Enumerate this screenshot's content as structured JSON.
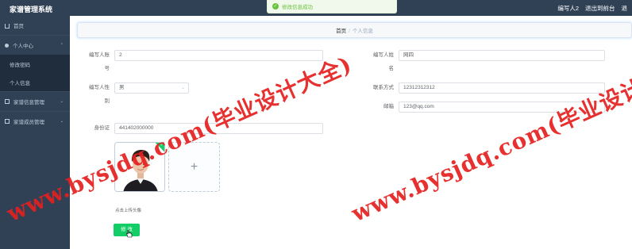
{
  "topbar": {
    "brand": "家谱管理系统",
    "user_label": "编写人2",
    "exit_label": "退出到前台",
    "extra_label": "退"
  },
  "toast": {
    "message": "修改信息成功"
  },
  "sidebar": {
    "items": [
      {
        "label": "首页",
        "icon": "home-icon"
      },
      {
        "label": "个人中心",
        "icon": "user-icon"
      },
      {
        "label": "修改密码",
        "sub": true
      },
      {
        "label": "个人信息",
        "sub": true
      },
      {
        "label": "家谱信息管理",
        "icon": "grid-icon"
      },
      {
        "label": "家谱成员管理",
        "icon": "grid-icon"
      }
    ]
  },
  "breadcrumb": {
    "home": "首页",
    "separator": "/",
    "current": "个人信息"
  },
  "form": {
    "account_label_1": "编写人账",
    "account_label_2": "号",
    "account_value": "2",
    "gender_label_1": "编写人性",
    "gender_label_2": "别",
    "gender_value": "男",
    "idcard_label": "身份证",
    "idcard_value": "441402000000",
    "name_label_1": "编写人姓",
    "name_label_2": "名",
    "name_value": "网四",
    "phone_label": "联系方式",
    "phone_value": "12312312312",
    "email_label": "邮箱",
    "email_value": "123@qq.com",
    "upload_plus": "+",
    "upload_hint": "点击上传头像",
    "modify_button": "修 改"
  },
  "watermark": {
    "text_1": "www.bysjdq.com(毕业设计大全)",
    "text_2": "www.bysjdq.com(毕业设计"
  },
  "colors": {
    "sidebar_bg": "#304156",
    "accent_green": "#13ce66",
    "watermark_red": "#e62020"
  }
}
